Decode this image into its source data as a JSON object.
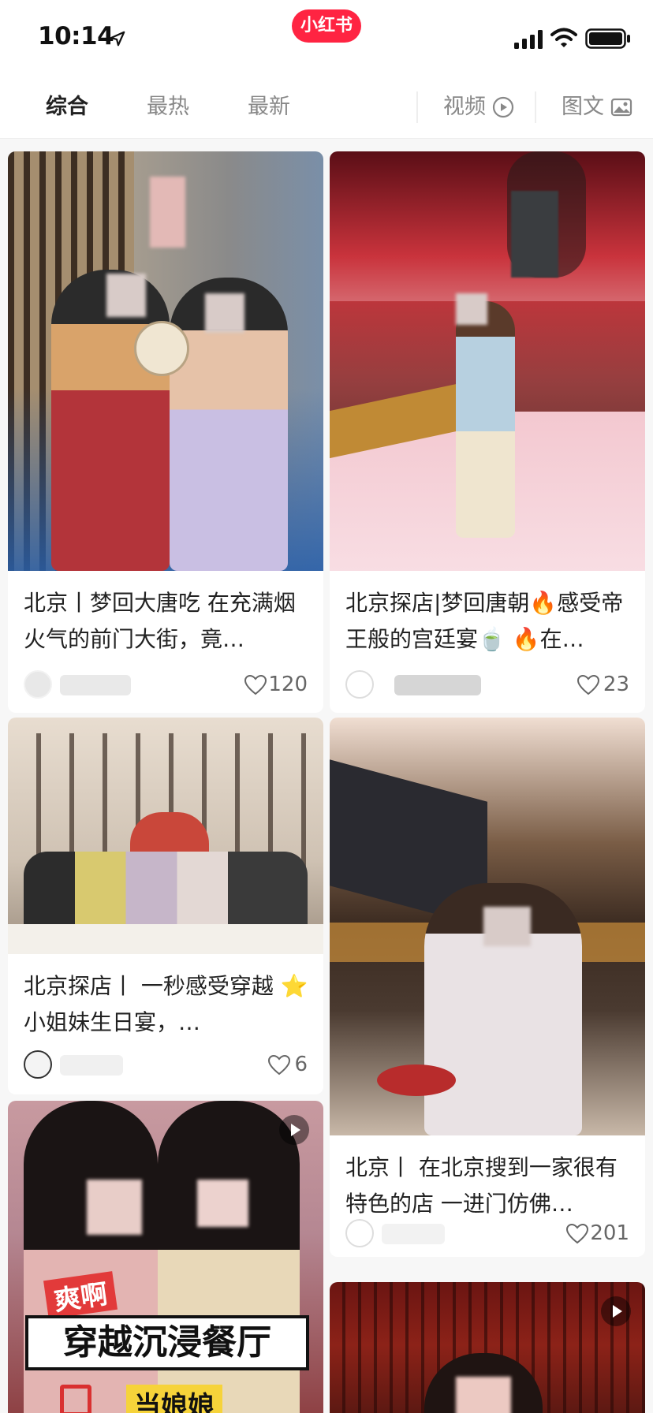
{
  "status_bar": {
    "time": "10:14",
    "app_logo_text": "小红书",
    "icons": [
      "location-arrow-icon",
      "signal-icon",
      "wifi-icon",
      "battery-icon"
    ]
  },
  "tabs": {
    "items": [
      {
        "label": "综合",
        "active": true
      },
      {
        "label": "最热",
        "active": false
      },
      {
        "label": "最新",
        "active": false
      }
    ],
    "video_label": "视频",
    "image_text_label": "图文"
  },
  "colors": {
    "brand": "#ff2442",
    "text_primary": "#222222",
    "text_secondary": "#888888",
    "background": "#f7f7f7"
  },
  "cards": [
    {
      "title": "北京丨梦回大唐吃 在充满烟火气的前门大街，竟…",
      "likes": "120",
      "has_video": false
    },
    {
      "title": "北京探店|梦回唐朝🔥感受帝王般的宫廷宴🍵 🔥在…",
      "likes": "23",
      "has_video": false
    },
    {
      "title": "北京探店丨 一秒感受穿越 ⭐小姐妹生日宴，…",
      "likes": "6",
      "has_video": false
    },
    {
      "title": "北京丨 在北京搜到一家很有特色的店 一进门仿佛…",
      "likes": "201",
      "has_video": false
    },
    {
      "overlay_text_top": "爽啊",
      "overlay_text_main": "穿越沉浸餐厅",
      "overlay_text_bottom": "当娘娘",
      "has_video": true
    },
    {
      "has_video": true
    }
  ]
}
